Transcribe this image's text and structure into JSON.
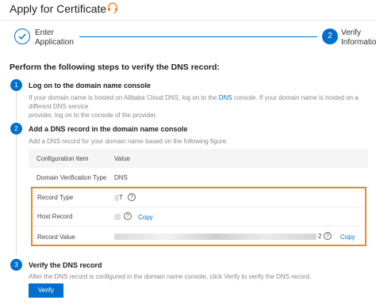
{
  "header": {
    "title": "Apply for Certificate"
  },
  "steps": [
    {
      "number": "",
      "label_line1": "Enter",
      "label_line2": "Application",
      "state": "done"
    },
    {
      "number": "2",
      "label_line1": "Verify",
      "label_line2": "Informatio",
      "state": "active"
    }
  ],
  "section_title": "Perform the following steps to verify the DNS record:",
  "step1": {
    "num": "1",
    "title": "Log on to the domain name console",
    "desc_a": "If your domain name is hosted on Alibaba Cloud DNS, log on to the ",
    "desc_link": "DNS",
    "desc_b": " console. If your domain name is hosted on a different DNS service",
    "desc_c": "provider, log on to the console of the provider."
  },
  "step2": {
    "num": "2",
    "title": "Add a DNS record in the domain name console",
    "desc": "Add a DNS record for your domain name based on the following figure."
  },
  "table": {
    "header_key": "Configuration Item",
    "header_val": "Value",
    "dvt_key": "Domain Verification Type",
    "dvt_val": "DNS",
    "record_type_key": "Record Type",
    "record_type_val": "T",
    "host_record_key": "Host Record",
    "record_value_key": "Record Value",
    "copy_label": "Copy",
    "record_value_tail": "2"
  },
  "step3": {
    "num": "3",
    "title": "Verify the DNS record",
    "desc": "After the DNS record is configured in the domain name console, click Verify to verify the DNS record.",
    "button": "Verify"
  },
  "colors": {
    "primary": "#0070cc",
    "highlight": "#f08a24"
  }
}
